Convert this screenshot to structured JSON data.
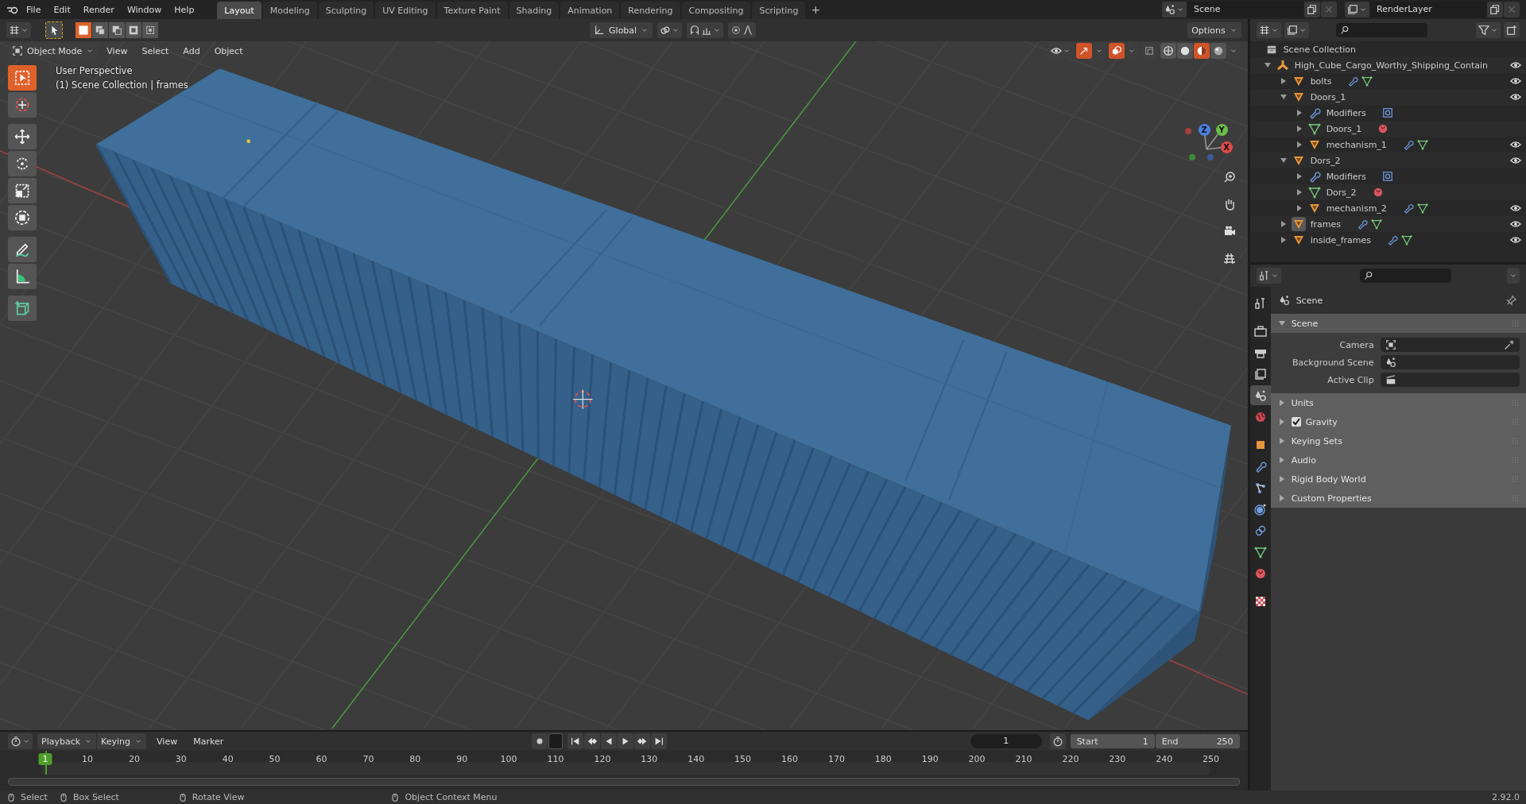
{
  "top_menu": [
    "File",
    "Edit",
    "Render",
    "Window",
    "Help"
  ],
  "workspaces": [
    {
      "label": "Layout",
      "selected": true
    },
    {
      "label": "Modeling",
      "selected": false
    },
    {
      "label": "Sculpting",
      "selected": false
    },
    {
      "label": "UV Editing",
      "selected": false
    },
    {
      "label": "Texture Paint",
      "selected": false
    },
    {
      "label": "Shading",
      "selected": false
    },
    {
      "label": "Animation",
      "selected": false
    },
    {
      "label": "Rendering",
      "selected": false
    },
    {
      "label": "Compositing",
      "selected": false
    },
    {
      "label": "Scripting",
      "selected": false
    }
  ],
  "add_workspace": "+",
  "scene": "Scene",
  "view_layer": "RenderLayer",
  "tool_header": {
    "select_modes": [
      {
        "selected": true
      },
      {
        "selected": false
      },
      {
        "selected": false
      },
      {
        "selected": false
      },
      {
        "selected": false
      }
    ],
    "orientation": "Global",
    "options": "Options"
  },
  "viewport": {
    "mode": "Object Mode",
    "menus": [
      "View",
      "Select",
      "Add",
      "Object"
    ],
    "view_name": "User Perspective",
    "context": "(1) Scene Collection | frames",
    "tools": [
      {
        "kind": "select",
        "selected": true
      },
      {
        "kind": "cursor",
        "selected": false
      },
      {
        "kind": "move",
        "selected": false
      },
      {
        "kind": "rotate",
        "selected": false
      },
      {
        "kind": "scale",
        "selected": false
      },
      {
        "kind": "transform",
        "selected": false
      },
      {
        "kind": "annotate",
        "selected": false
      },
      {
        "kind": "measure",
        "selected": false
      },
      {
        "kind": "add_cube",
        "selected": false
      }
    ],
    "gizmo_axes": [
      {
        "label": "Z",
        "kind": "z"
      },
      {
        "label": "Y",
        "kind": "y"
      },
      {
        "label": "X",
        "kind": "x"
      }
    ],
    "shading_modes": [
      {
        "kind": "wireframe",
        "selected": false
      },
      {
        "kind": "solid",
        "selected": false
      },
      {
        "kind": "material",
        "selected": true
      },
      {
        "kind": "rendered",
        "selected": false
      }
    ]
  },
  "outliner": {
    "root": "Scene Collection",
    "items": [
      {
        "label": "High_Cube_Cargo_Worthy_Shipping_Contain",
        "kind": "empty",
        "expanded": true,
        "active": false,
        "children": [
          {
            "label": "bolts",
            "kind": "object",
            "expanded": false,
            "active": false
          },
          {
            "label": "Doors_1",
            "kind": "object",
            "expanded": true,
            "active": false,
            "children": [
              {
                "label": "Modifiers",
                "kind": "modifiers",
                "expanded": false,
                "active": false
              },
              {
                "label": "Doors_1",
                "kind": "mesh",
                "expanded": false,
                "active": false
              },
              {
                "label": "mechanism_1",
                "kind": "object",
                "expanded": false,
                "active": false
              }
            ]
          },
          {
            "label": "Dors_2",
            "kind": "object",
            "expanded": true,
            "active": false,
            "children": [
              {
                "label": "Modifiers",
                "kind": "modifiers",
                "expanded": false,
                "active": false
              },
              {
                "label": "Dors_2",
                "kind": "mesh",
                "expanded": false,
                "active": false
              },
              {
                "label": "mechanism_2",
                "kind": "object",
                "expanded": false,
                "active": false
              }
            ]
          },
          {
            "label": "frames",
            "kind": "object",
            "expanded": false,
            "active": true
          },
          {
            "label": "inside_frames",
            "kind": "object",
            "expanded": false,
            "active": false
          }
        ]
      }
    ]
  },
  "properties": {
    "tabs": [
      {
        "kind": "tool",
        "selected": false
      },
      {
        "kind": "render",
        "selected": false
      },
      {
        "kind": "output",
        "selected": false
      },
      {
        "kind": "view_layer",
        "selected": false
      },
      {
        "kind": "scene",
        "selected": true
      },
      {
        "kind": "world",
        "selected": false
      },
      {
        "kind": "object",
        "selected": false
      },
      {
        "kind": "modifiers",
        "selected": false
      },
      {
        "kind": "particles",
        "selected": false
      },
      {
        "kind": "physics",
        "selected": false
      },
      {
        "kind": "constraints",
        "selected": false
      },
      {
        "kind": "data",
        "selected": false
      },
      {
        "kind": "material",
        "selected": false
      },
      {
        "kind": "texture",
        "selected": false
      }
    ],
    "context": "Scene",
    "panels": [
      {
        "label": "Scene",
        "kind": "plain",
        "expanded": true,
        "fields": [
          {
            "label": "Camera",
            "kind": "camera"
          },
          {
            "label": "Background Scene",
            "kind": "scene"
          },
          {
            "label": "Active Clip",
            "kind": "clip"
          }
        ]
      },
      {
        "label": "Units",
        "kind": "plain",
        "expanded": false
      },
      {
        "label": "Gravity",
        "kind": "checkbox",
        "checked": true,
        "expanded": false
      },
      {
        "label": "Keying Sets",
        "kind": "plain",
        "expanded": false
      },
      {
        "label": "Audio",
        "kind": "plain",
        "expanded": false
      },
      {
        "label": "Rigid Body World",
        "kind": "plain",
        "expanded": false
      },
      {
        "label": "Custom Properties",
        "kind": "plain",
        "expanded": false
      }
    ]
  },
  "timeline": {
    "dropdowns": [
      "Playback",
      "Keying"
    ],
    "menus": [
      "View",
      "Marker"
    ],
    "current_frame": "1",
    "start_label": "Start",
    "start": "1",
    "end_label": "End",
    "end": "250",
    "playhead": "1",
    "ticks": [
      "10",
      "20",
      "30",
      "40",
      "50",
      "60",
      "70",
      "80",
      "90",
      "100",
      "110",
      "120",
      "130",
      "140",
      "150",
      "160",
      "170",
      "180",
      "190",
      "200",
      "210",
      "220",
      "230",
      "240",
      "250"
    ]
  },
  "status_bar": {
    "hints": [
      "Select",
      "Box Select",
      "Rotate View",
      "Object Context Menu"
    ],
    "version": "2.92.0"
  }
}
